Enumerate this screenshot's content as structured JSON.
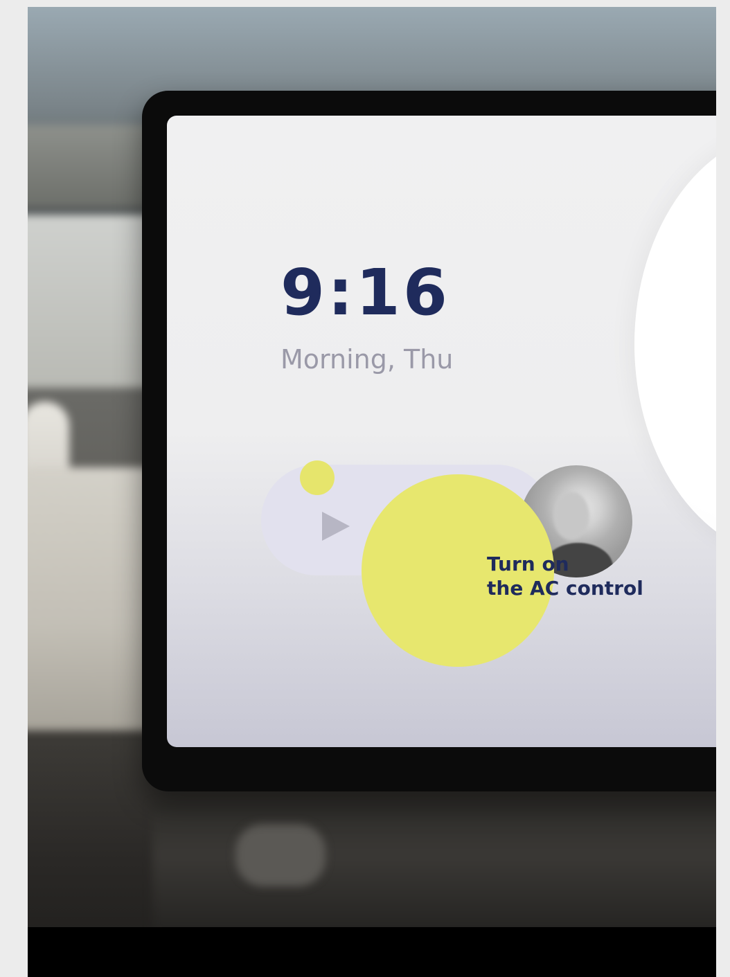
{
  "clock": {
    "time": "9:16",
    "subtitle": "Morning, Thu"
  },
  "media": {
    "play_icon": "play-icon",
    "avatar_icon": "user-avatar"
  },
  "suggestion": {
    "line1": "Turn on",
    "line2": "the AC control"
  },
  "colors": {
    "accent_yellow": "#e7e76e",
    "text_navy": "#1f2b5c",
    "subtitle_gray": "#9a99a8",
    "pill_lavender": "#e2e1ee"
  }
}
